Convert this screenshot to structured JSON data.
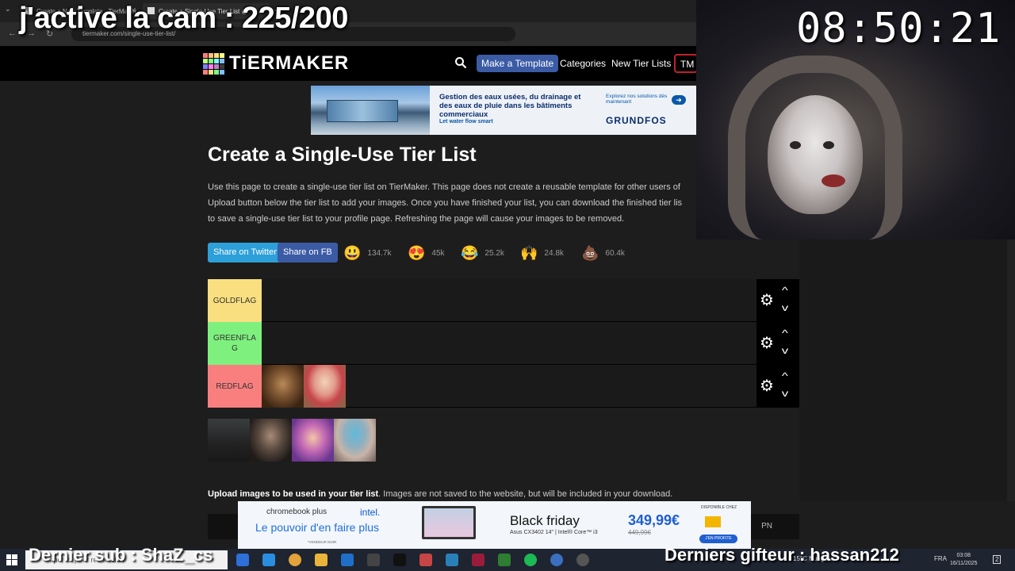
{
  "overlay": {
    "cam_title": "j'active la cam : 225/200",
    "clock": "08:50:21",
    "last_sub": "Dernier sub : ShaZ_cs",
    "last_gifter": "Derniers gifteur : hassan212"
  },
  "browser": {
    "tabs": [
      {
        "label": "Create a New Template - TierMaker"
      },
      {
        "label": "Create a Single-Use Tier List @"
      }
    ],
    "url": "tiermaker.com/single-use-tier-list/"
  },
  "site": {
    "logo": "TiERMAKER",
    "nav": {
      "make_template": "Make a Template",
      "categories": "Categories",
      "new_tier_lists": "New Tier Lists",
      "tm": "TM"
    }
  },
  "ad_top": {
    "headline": "Gestion des eaux usées, du drainage et des eaux de pluie dans les bâtiments commerciaux",
    "tagline": "Let water flow smart",
    "cta": "Explorez nos solutions dès maintenant",
    "brand": "GRUNDFOS"
  },
  "page": {
    "title": "Create a Single-Use Tier List",
    "desc_lines": [
      "Use this page to create a single-use tier list on TierMaker. This page does not create a reusable template for other users of",
      "Upload button below the tier list to add your images. Once you have finished your list, you can download the finished tier lis",
      "to save a single-use tier list to your profile page. Refreshing the page will cause your images to be removed."
    ],
    "share_twitter": "Share on Twitter",
    "share_fb": "Share on FB",
    "reactions": [
      {
        "emoji": "😃",
        "count": "134.7k"
      },
      {
        "emoji": "😍",
        "count": "45k"
      },
      {
        "emoji": "😂",
        "count": "25.2k"
      },
      {
        "emoji": "🙌",
        "count": "24.8k"
      },
      {
        "emoji": "💩",
        "count": "60.4k"
      }
    ],
    "upload_bold": "Upload images to be used in your tier list",
    "upload_rest": ". Images are not saved to the website, but will be included in your download.",
    "pn_label": "PN"
  },
  "tiers": [
    {
      "label": "GOLDFLAG",
      "color": "#f9df80"
    },
    {
      "label": "GREENFLAG",
      "color": "#7ef07e"
    },
    {
      "label": "REDFLAG",
      "color": "#f97f7f"
    }
  ],
  "ad_bottom": {
    "chromebook": "chromebook plus",
    "intel": "intel.",
    "slogan": "Le pouvoir d'en faire plus",
    "disclaimer": "*VENDEUR NOIR",
    "black_friday": "Black friday",
    "model": "Asus CX3402 14\" | Intel® Core™ i3",
    "price": "349,99€",
    "old_price": "449,99€",
    "availability": "DISPONIBLE CHEZ",
    "promo": "J'EN PROFITE"
  },
  "taskbar": {
    "search_placeholder": "Taper ici pour rechercher",
    "weather": "15°C Nuageux",
    "lang": "FRA",
    "time": "03:08",
    "date": "16/11/2025",
    "notif_count": "2"
  }
}
